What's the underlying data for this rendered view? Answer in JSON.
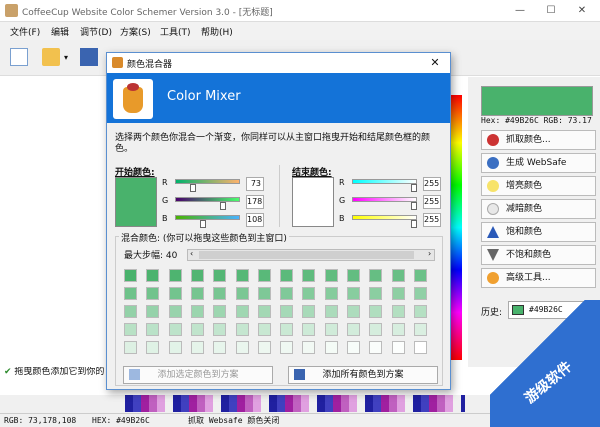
{
  "app": {
    "title": "CoffeeCup Website Color Schemer Version 3.0 - [无标题]",
    "window_controls": [
      "—",
      "☐",
      "✕"
    ]
  },
  "menu": [
    "文件(F)",
    "编辑",
    "调节(D)",
    "方案(S)",
    "工具(T)",
    "帮助(H)"
  ],
  "right_panel": {
    "color": "#49b26c",
    "hex_rgb": "Hex: #49B26C   RGB: 73.17",
    "buttons": [
      {
        "label": "抓取颜色...",
        "icon": "eyedropper-icon"
      },
      {
        "label": "生成 WebSafe",
        "icon": "websafe-icon"
      },
      {
        "label": "增亮颜色",
        "icon": "lighten-bulb-icon"
      },
      {
        "label": "减暗颜色",
        "icon": "darken-bulb-icon"
      },
      {
        "label": "饱和颜色",
        "icon": "saturate-icon"
      },
      {
        "label": "不饱和颜色",
        "icon": "desaturate-icon"
      },
      {
        "label": "高级工具...",
        "icon": "advanced-tools-icon"
      }
    ],
    "history_label": "历史:",
    "history_value": "#49B26C"
  },
  "hint": "拖曳颜色添加它到你的",
  "status": {
    "rgb": "RGB: 73,178,108",
    "hex": "HEX: #49B26C",
    "websafe": "抓取 Websafe 颜色关闭"
  },
  "dialog": {
    "title": "颜色混合器",
    "close": "✕",
    "banner_title": "Color Mixer",
    "description": "选择两个颜色你混合一个渐变，你同样可以从主窗口拖曳开始和结尾颜色框的颜色。",
    "start": {
      "label": "开始颜色:",
      "color": "#49b26c",
      "channels": [
        {
          "name": "R",
          "value": "73",
          "fraction": 0.286
        },
        {
          "name": "G",
          "value": "178",
          "fraction": 0.698
        },
        {
          "name": "B",
          "value": "108",
          "fraction": 0.424
        }
      ]
    },
    "end": {
      "label": "结束颜色:",
      "color": "#ffffff",
      "channels": [
        {
          "name": "R",
          "value": "255",
          "fraction": 1.0
        },
        {
          "name": "G",
          "value": "255",
          "fraction": 1.0
        },
        {
          "name": "B",
          "value": "255",
          "fraction": 1.0
        }
      ]
    },
    "mix_label": "混合颜色: (你可以拖曳这些颜色到主窗口)",
    "steps_label": "最大步幅: 40",
    "add_selected": "添加选定颜色到方案",
    "add_all": "添加所有颜色到方案"
  },
  "watermark": "游级软件"
}
